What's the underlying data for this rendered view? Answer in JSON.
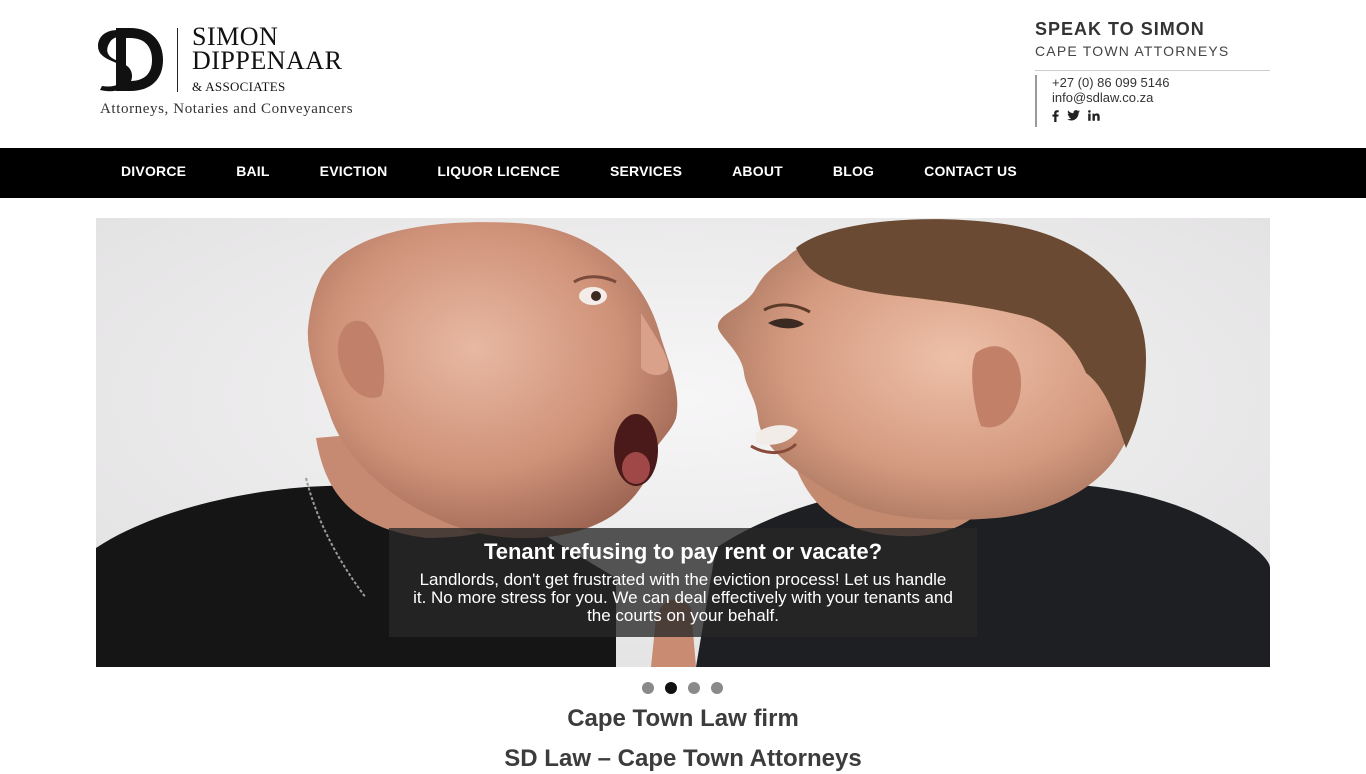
{
  "logo": {
    "mark": "SD",
    "name_line1": "SIMON",
    "name_line2": "DIPPENAAR",
    "name_line3": "& ASSOCIATES",
    "tagline": "Attorneys, Notaries and Conveyancers"
  },
  "contact": {
    "title": "SPEAK TO SIMON",
    "subtitle": "CAPE TOWN ATTORNEYS",
    "phone": "+27 (0) 86 099 5146",
    "email": "info@sdlaw.co.za",
    "social": [
      {
        "icon": "facebook-icon",
        "glyph": "f"
      },
      {
        "icon": "twitter-icon",
        "glyph": "t"
      },
      {
        "icon": "linkedin-icon",
        "glyph": "in"
      }
    ]
  },
  "nav": {
    "items": [
      {
        "label": "DIVORCE"
      },
      {
        "label": "BAIL"
      },
      {
        "label": "EVICTION"
      },
      {
        "label": "LIQUOR LICENCE"
      },
      {
        "label": "SERVICES"
      },
      {
        "label": "ABOUT"
      },
      {
        "label": "BLOG"
      },
      {
        "label": "CONTACT US"
      }
    ]
  },
  "hero": {
    "caption_title": "Tenant refusing to pay rent or vacate?",
    "caption_text": "Landlords, don't get frustrated with the eviction process! Let us handle it. No more stress for you. We can deal effectively with your tenants and the courts on your behalf.",
    "slide_count": 4,
    "active_slide": 2
  },
  "content": {
    "title": "Cape Town Law firm",
    "subtitle": "SD Law – Cape Town Attorneys"
  },
  "colors": {
    "nav_background": "#000000",
    "nav_text": "#ffffff",
    "dot_inactive": "#8a8a8a",
    "dot_active": "#111111",
    "caption_background": "#282828"
  }
}
